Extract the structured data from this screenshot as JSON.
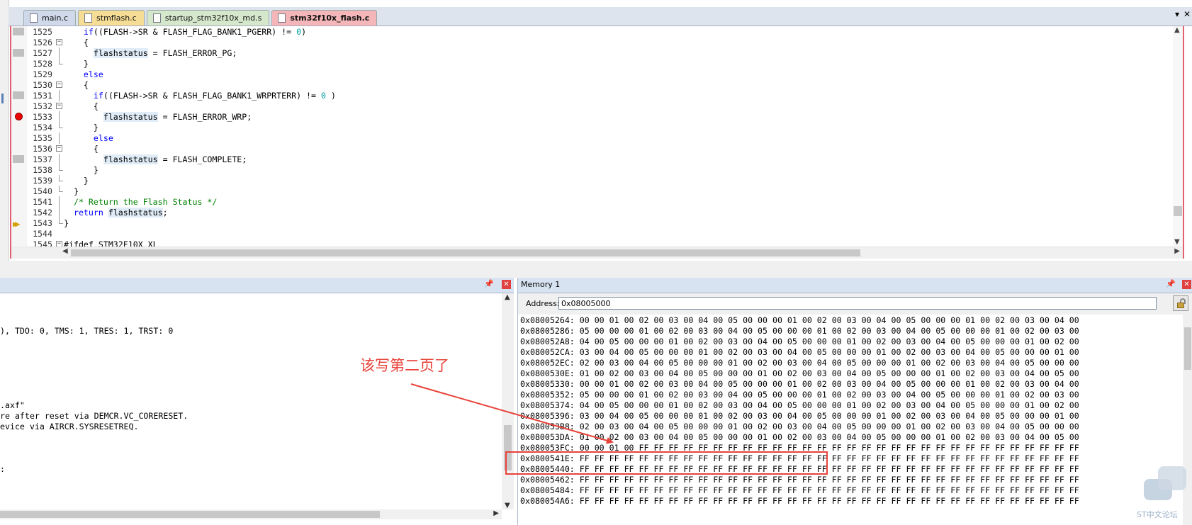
{
  "tabs": [
    {
      "label": "main.c",
      "active": false
    },
    {
      "label": "stmflash.c",
      "active": false
    },
    {
      "label": "startup_stm32f10x_md.s",
      "active": false
    },
    {
      "label": "stm32f10x_flash.c",
      "active": true
    }
  ],
  "tab_controls": {
    "menu": "▾",
    "close": "✕"
  },
  "editor": {
    "lines": [
      {
        "no": "1525",
        "marker": "box",
        "fold": "",
        "parts": [
          [
            "",
            "    "
          ],
          [
            "kw",
            "if"
          ],
          [
            "",
            "((FLASH->SR & FLASH_FLAG_BANK1_PGERR) != "
          ],
          [
            "num",
            "0"
          ],
          [
            "",
            ")"
          ]
        ]
      },
      {
        "no": "1526",
        "marker": "",
        "fold": "minus",
        "parts": [
          [
            "",
            "    {"
          ]
        ]
      },
      {
        "no": "1527",
        "marker": "box",
        "fold": "line",
        "parts": [
          [
            "",
            "      "
          ],
          [
            "hl",
            "flashstatus"
          ],
          [
            "",
            " = FLASH_ERROR_PG;"
          ]
        ]
      },
      {
        "no": "1528",
        "marker": "",
        "fold": "end",
        "parts": [
          [
            "",
            "    }"
          ]
        ]
      },
      {
        "no": "1529",
        "marker": "",
        "fold": "",
        "parts": [
          [
            "",
            "    "
          ],
          [
            "kw",
            "else"
          ]
        ]
      },
      {
        "no": "1530",
        "marker": "",
        "fold": "minus",
        "parts": [
          [
            "",
            "    {"
          ]
        ]
      },
      {
        "no": "1531",
        "marker": "box",
        "fold": "line",
        "parts": [
          [
            "",
            "      "
          ],
          [
            "kw",
            "if"
          ],
          [
            "",
            "((FLASH->SR & FLASH_FLAG_BANK1_WRPRTERR) != "
          ],
          [
            "num",
            "0"
          ],
          [
            "",
            " )"
          ]
        ]
      },
      {
        "no": "1532",
        "marker": "",
        "fold": "minus",
        "parts": [
          [
            "",
            "      {"
          ]
        ]
      },
      {
        "no": "1533",
        "marker": "bp",
        "fold": "line",
        "parts": [
          [
            "",
            "        "
          ],
          [
            "hl",
            "flashstatus"
          ],
          [
            "",
            " = FLASH_ERROR_WRP;"
          ]
        ]
      },
      {
        "no": "1534",
        "marker": "",
        "fold": "end",
        "parts": [
          [
            "",
            "      }"
          ]
        ]
      },
      {
        "no": "1535",
        "marker": "",
        "fold": "line",
        "parts": [
          [
            "",
            "      "
          ],
          [
            "kw",
            "else"
          ]
        ]
      },
      {
        "no": "1536",
        "marker": "",
        "fold": "minus",
        "parts": [
          [
            "",
            "      {"
          ]
        ]
      },
      {
        "no": "1537",
        "marker": "box",
        "fold": "line",
        "parts": [
          [
            "",
            "        "
          ],
          [
            "hl",
            "flashstatus"
          ],
          [
            "",
            " = FLASH_COMPLETE;"
          ]
        ]
      },
      {
        "no": "1538",
        "marker": "",
        "fold": "end",
        "parts": [
          [
            "",
            "      }"
          ]
        ]
      },
      {
        "no": "1539",
        "marker": "",
        "fold": "end",
        "parts": [
          [
            "",
            "    }"
          ]
        ]
      },
      {
        "no": "1540",
        "marker": "",
        "fold": "end",
        "parts": [
          [
            "",
            "  }"
          ]
        ]
      },
      {
        "no": "1541",
        "marker": "",
        "fold": "line",
        "parts": [
          [
            "",
            "  "
          ],
          [
            "cmt",
            "/* Return the Flash Status */"
          ]
        ]
      },
      {
        "no": "1542",
        "marker": "",
        "fold": "line",
        "parts": [
          [
            "",
            "  "
          ],
          [
            "kw",
            "return"
          ],
          [
            "",
            " "
          ],
          [
            "hl",
            "flashstatus"
          ],
          [
            "",
            ";"
          ]
        ]
      },
      {
        "no": "1543",
        "marker": "arrow",
        "fold": "end",
        "parts": [
          [
            "",
            "}"
          ]
        ]
      },
      {
        "no": "1544",
        "marker": "",
        "fold": "",
        "parts": [
          [
            "",
            ""
          ]
        ]
      },
      {
        "no": "1545",
        "marker": "",
        "fold": "minus",
        "parts": [
          [
            "",
            "#ifdef STM32F10X_XL"
          ]
        ]
      }
    ]
  },
  "command": {
    "lines": [
      "",
      "",
      "",
      "), TDO: 0, TMS: 1, TRES: 1, TRST: 0",
      "",
      "",
      "",
      "",
      "",
      "",
      ".axf\"",
      "re after reset via DEMCR.VC_CORERESET.",
      "evice via AIRCR.SYSRESETREQ.",
      "",
      "",
      "",
      ":",
      "",
      ""
    ]
  },
  "memory": {
    "title": "Memory 1",
    "address_label": "Address:",
    "address_value": "0x08005000",
    "rows": [
      "0x08005264: 00 00 01 00 02 00 03 00 04 00 05 00 00 00 01 00 02 00 03 00 04 00 05 00 00 00 01 00 02 00 03 00 04 00",
      "0x08005286: 05 00 00 00 01 00 02 00 03 00 04 00 05 00 00 00 01 00 02 00 03 00 04 00 05 00 00 00 01 00 02 00 03 00",
      "0x080052A8: 04 00 05 00 00 00 01 00 02 00 03 00 04 00 05 00 00 00 01 00 02 00 03 00 04 00 05 00 00 00 01 00 02 00",
      "0x080052CA: 03 00 04 00 05 00 00 00 01 00 02 00 03 00 04 00 05 00 00 00 01 00 02 00 03 00 04 00 05 00 00 00 01 00",
      "0x080052EC: 02 00 03 00 04 00 05 00 00 00 01 00 02 00 03 00 04 00 05 00 00 00 01 00 02 00 03 00 04 00 05 00 00 00",
      "0x0800530E: 01 00 02 00 03 00 04 00 05 00 00 00 01 00 02 00 03 00 04 00 05 00 00 00 01 00 02 00 03 00 04 00 05 00",
      "0x08005330: 00 00 01 00 02 00 03 00 04 00 05 00 00 00 01 00 02 00 03 00 04 00 05 00 00 00 01 00 02 00 03 00 04 00",
      "0x08005352: 05 00 00 00 01 00 02 00 03 00 04 00 05 00 00 00 01 00 02 00 03 00 04 00 05 00 00 00 01 00 02 00 03 00",
      "0x08005374: 04 00 05 00 00 00 01 00 02 00 03 00 04 00 05 00 00 00 01 00 02 00 03 00 04 00 05 00 00 00 01 00 02 00",
      "0x08005396: 03 00 04 00 05 00 00 00 01 00 02 00 03 00 04 00 05 00 00 00 01 00 02 00 03 00 04 00 05 00 00 00 01 00",
      "0x080053B8: 02 00 03 00 04 00 05 00 00 00 01 00 02 00 03 00 04 00 05 00 00 00 01 00 02 00 03 00 04 00 05 00 00 00",
      "0x080053DA: 01 00 02 00 03 00 04 00 05 00 00 00 01 00 02 00 03 00 04 00 05 00 00 00 01 00 02 00 03 00 04 00 05 00",
      "0x080053FC: 00 00 01 00 FF FF FF FF FF FF FF FF FF FF FF FF FF FF FF FF FF FF FF FF FF FF FF FF FF FF FF FF FF FF",
      "0x0800541E: FF FF FF FF FF FF FF FF FF FF FF FF FF FF FF FF FF FF FF FF FF FF FF FF FF FF FF FF FF FF FF FF FF FF",
      "0x08005440: FF FF FF FF FF FF FF FF FF FF FF FF FF FF FF FF FF FF FF FF FF FF FF FF FF FF FF FF FF FF FF FF FF FF",
      "0x08005462: FF FF FF FF FF FF FF FF FF FF FF FF FF FF FF FF FF FF FF FF FF FF FF FF FF FF FF FF FF FF FF FF FF FF",
      "0x08005484: FF FF FF FF FF FF FF FF FF FF FF FF FF FF FF FF FF FF FF FF FF FF FF FF FF FF FF FF FF FF FF FF FF FF",
      "0x080054A6: FF FF FF FF FF FF FF FF FF FF FF FF FF FF FF FF FF FF FF FF FF FF FF FF FF FF FF FF FF FF FF FF FF FF"
    ]
  },
  "annotation": {
    "text": "该写第二页了",
    "color": "#e8433a"
  },
  "watermark": {
    "text": "ST中文论坛"
  }
}
